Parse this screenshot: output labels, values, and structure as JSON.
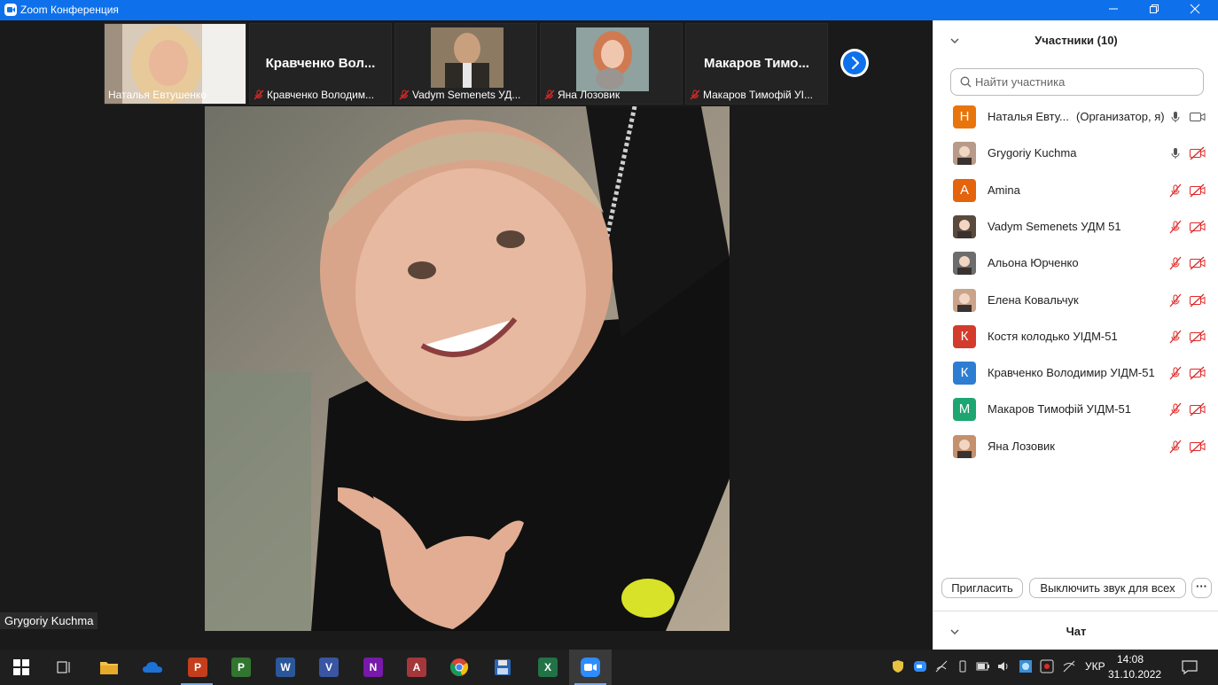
{
  "window": {
    "title": "Zoom Конференция",
    "controls": [
      "minimize",
      "restore",
      "close"
    ]
  },
  "thumbnails": [
    {
      "name": "Наталья Евтушенко",
      "big_label": "",
      "muted": false,
      "has_video": true
    },
    {
      "name": "Кравченко Володим...",
      "big_label": "Кравченко Вол...",
      "muted": true,
      "has_video": false
    },
    {
      "name": "Vadym Semenets УД...",
      "big_label": "",
      "muted": true,
      "has_video": true
    },
    {
      "name": "Яна Лозовик",
      "big_label": "",
      "muted": true,
      "has_video": true
    },
    {
      "name": "Макаров Тимофій УІ...",
      "big_label": "Макаров Тимо...",
      "muted": true,
      "has_video": false
    }
  ],
  "main_video": {
    "speaker_name": "Grygoriy Kuchma"
  },
  "participants_panel": {
    "title": "Участники (10)",
    "search_placeholder": "Найти участника",
    "participants": [
      {
        "name": "Наталья Евту...",
        "role": "(Организатор, я)",
        "avatar_letter": "Н",
        "avatar_color": "#e8750c",
        "mic": "on",
        "camera": "on"
      },
      {
        "name": "Grygoriy Kuchma",
        "role": "",
        "avatar_letter": "",
        "avatar_color": "#b89a8a",
        "mic": "on",
        "camera": "off"
      },
      {
        "name": "Amina",
        "role": "",
        "avatar_letter": "A",
        "avatar_color": "#e4630d",
        "mic": "off",
        "camera": "off"
      },
      {
        "name": "Vadym Semenets УДМ 51",
        "role": "",
        "avatar_letter": "",
        "avatar_color": "#5a4a3e",
        "mic": "off",
        "camera": "off"
      },
      {
        "name": "Альона Юрченко",
        "role": "",
        "avatar_letter": "",
        "avatar_color": "#6d6d6d",
        "mic": "off",
        "camera": "off"
      },
      {
        "name": "Елена Ковальчук",
        "role": "",
        "avatar_letter": "",
        "avatar_color": "#c9a48a",
        "mic": "off",
        "camera": "off"
      },
      {
        "name": "Костя колодько УІДМ-51",
        "role": "",
        "avatar_letter": "К",
        "avatar_color": "#d33b2c",
        "mic": "off",
        "camera": "off"
      },
      {
        "name": "Кравченко Володимир УІДМ-51",
        "role": "",
        "avatar_letter": "К",
        "avatar_color": "#2d7dd2",
        "mic": "off",
        "camera": "off"
      },
      {
        "name": "Макаров Тимофій УІДМ-51",
        "role": "",
        "avatar_letter": "М",
        "avatar_color": "#1ea672",
        "mic": "off",
        "camera": "off"
      },
      {
        "name": "Яна Лозовик",
        "role": "",
        "avatar_letter": "",
        "avatar_color": "#c4906e",
        "mic": "off",
        "camera": "off"
      }
    ],
    "invite_label": "Пригласить",
    "mute_all_label": "Выключить звук для всех",
    "more_label": "···",
    "chat_title": "Чат"
  },
  "taskbar": {
    "apps": [
      {
        "name": "start",
        "color": "#1f1f1f",
        "letter": "",
        "active": false
      },
      {
        "name": "task-view",
        "color": "#1f1f1f",
        "letter": "",
        "active": false
      },
      {
        "name": "file-explorer",
        "color": "#f2c04b",
        "letter": "",
        "active": false
      },
      {
        "name": "onedrive",
        "color": "#1f1f1f",
        "letter": "",
        "active": false
      },
      {
        "name": "powerpoint",
        "color": "#c43e1c",
        "letter": "P",
        "active": true
      },
      {
        "name": "project",
        "color": "#31752f",
        "letter": "P",
        "active": false
      },
      {
        "name": "word",
        "color": "#2b579a",
        "letter": "W",
        "active": false
      },
      {
        "name": "visio",
        "color": "#3955a3",
        "letter": "V",
        "active": false
      },
      {
        "name": "onenote",
        "color": "#7719aa",
        "letter": "N",
        "active": false
      },
      {
        "name": "access",
        "color": "#a4373a",
        "letter": "A",
        "active": false
      },
      {
        "name": "chrome",
        "color": "#1f1f1f",
        "letter": "",
        "active": false
      },
      {
        "name": "save-app",
        "color": "#2a67b5",
        "letter": "",
        "active": false
      },
      {
        "name": "excel",
        "color": "#217346",
        "letter": "X",
        "active": false
      },
      {
        "name": "zoom",
        "color": "#2d8cff",
        "letter": "",
        "active": true
      }
    ],
    "language": "УКР",
    "time": "14:08",
    "date": "31.10.2022"
  },
  "colors": {
    "zoom_blue": "#0e71eb",
    "muted_red": "#e02828"
  }
}
